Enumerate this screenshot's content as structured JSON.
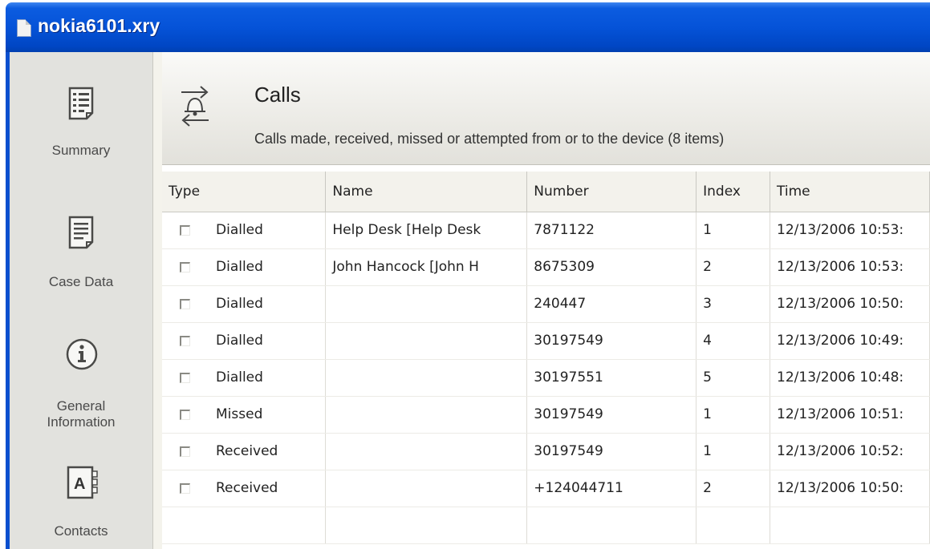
{
  "window": {
    "title": "nokia6101.xry"
  },
  "sidebar": {
    "items": [
      {
        "label": "Summary",
        "icon": "summary-list-icon"
      },
      {
        "label": "Case Data",
        "icon": "document-icon"
      },
      {
        "label_line1": "General",
        "label_line2": "Information",
        "icon": "info-icon"
      },
      {
        "label": "Contacts",
        "icon": "address-book-icon"
      }
    ]
  },
  "header": {
    "title": "Calls",
    "subtitle": "Calls made, received, missed or attempted from or to the device (8 items)",
    "icon": "calls-bell-arrows-icon"
  },
  "table": {
    "columns": [
      "Type",
      "Name",
      "Number",
      "Index",
      "Time"
    ],
    "rows": [
      {
        "type": "Dialled",
        "name": "Help Desk [Help Desk",
        "number": "7871122",
        "index": "1",
        "time": "12/13/2006 10:53:"
      },
      {
        "type": "Dialled",
        "name": "John Hancock [John H",
        "number": "8675309",
        "index": "2",
        "time": "12/13/2006 10:53:"
      },
      {
        "type": "Dialled",
        "name": "",
        "number": "240447",
        "index": "3",
        "time": "12/13/2006 10:50:"
      },
      {
        "type": "Dialled",
        "name": "",
        "number": "30197549",
        "index": "4",
        "time": "12/13/2006 10:49:"
      },
      {
        "type": "Dialled",
        "name": "",
        "number": "30197551",
        "index": "5",
        "time": "12/13/2006 10:48:"
      },
      {
        "type": "Missed",
        "name": "",
        "number": "30197549",
        "index": "1",
        "time": "12/13/2006 10:51:"
      },
      {
        "type": "Received",
        "name": "",
        "number": "30197549",
        "index": "1",
        "time": "12/13/2006 10:52:"
      },
      {
        "type": "Received",
        "name": "",
        "number": "+124044711",
        "index": "2",
        "time": "12/13/2006 10:50:"
      }
    ]
  },
  "colors": {
    "titlebar": "#0553d8",
    "sidebar": "#e2e2de",
    "header": "#ecebe6"
  }
}
